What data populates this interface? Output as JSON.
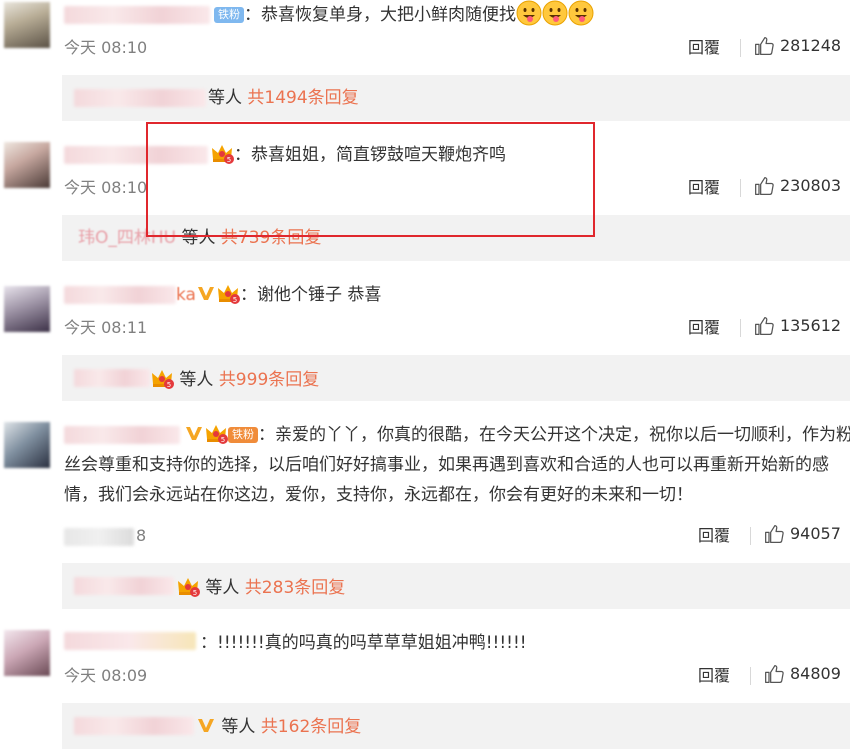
{
  "comments": [
    {
      "badge": "铁粉",
      "text": "：恭喜恢复单身，大把小鲜肉随便找",
      "time": "今天 08:10",
      "reply": "回覆",
      "likes": "281248",
      "sub_suffix": "等人",
      "sub_count": "共1494条回复"
    },
    {
      "text": "：恭喜姐姐，简直锣鼓喧天鞭炮齐鸣",
      "time": "今天 08:10",
      "reply": "回覆",
      "likes": "230803",
      "sub_name": "玮O_四林HU",
      "sub_suffix": "等人",
      "sub_count": "共739条回复"
    },
    {
      "name_tail": "ka",
      "text": "：谢他个锤子 恭喜",
      "time": "今天 08:11",
      "reply": "回覆",
      "likes": "135612",
      "sub_suffix": "等人",
      "sub_count": "共999条回复"
    },
    {
      "badge": "铁粉",
      "text": "：亲爱的丫丫，你真的很酷，在今天公开这个决定，祝你以后一切顺利，作为粉丝会尊重和支持你的选择，以后咱们好好搞事业，如果再遇到喜欢和合适的人也可以再重新开始新的感情，我们会永远站在你这边，爱你，支持你，永远都在，你会有更好的未来和一切！",
      "time_tail": "8",
      "reply": "回覆",
      "likes": "94057",
      "sub_suffix": "等人",
      "sub_count": "共283条回复"
    },
    {
      "text": "：!!!!!!!真的吗真的吗草草草姐姐冲鸭!!!!!!",
      "time": "今天 08:09",
      "reply": "回覆",
      "likes": "84809",
      "sub_suffix": "等人",
      "sub_count": "共162条回复"
    }
  ],
  "icons": {
    "like": "thumbs-up-icon",
    "vip": "verified-v-icon",
    "crown": "fan-crown-icon",
    "emoji": "tongue-face-emoji"
  },
  "colors": {
    "highlight": "#e0272d",
    "count": "#eb7350",
    "time": "#808080",
    "sub_bg": "#f2f2f2"
  }
}
